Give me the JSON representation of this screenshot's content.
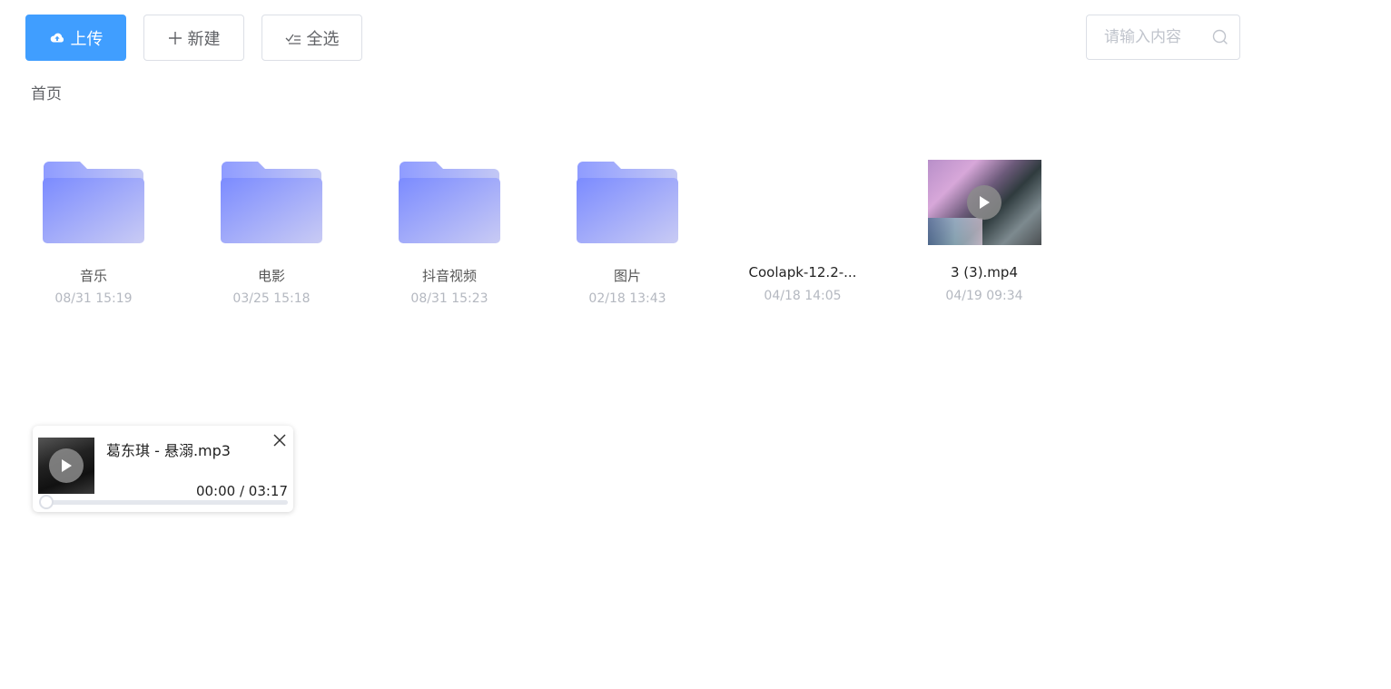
{
  "toolbar": {
    "upload_label": "上传",
    "new_label": "新建",
    "select_all_label": "全选"
  },
  "search": {
    "placeholder": "请输入内容"
  },
  "breadcrumb": {
    "home": "首页"
  },
  "files": [
    {
      "name": "音乐",
      "date": "08/31 15:19",
      "type": "folder"
    },
    {
      "name": "电影",
      "date": "03/25 15:18",
      "type": "folder"
    },
    {
      "name": "抖音视频",
      "date": "08/31 15:23",
      "type": "folder"
    },
    {
      "name": "图片",
      "date": "02/18 13:43",
      "type": "folder"
    },
    {
      "name": "Coolapk-12.2-...",
      "date": "04/18 14:05",
      "type": "file"
    },
    {
      "name": "3 (3).mp4",
      "date": "04/19 09:34",
      "type": "video"
    }
  ],
  "player": {
    "title": "葛东琪 - 悬溺.mp3",
    "time": "00:00 / 03:17",
    "progress": 0
  },
  "colors": {
    "primary": "#409eff",
    "folder_top": "#a5b4ff",
    "folder_front": "#7f8cff"
  }
}
